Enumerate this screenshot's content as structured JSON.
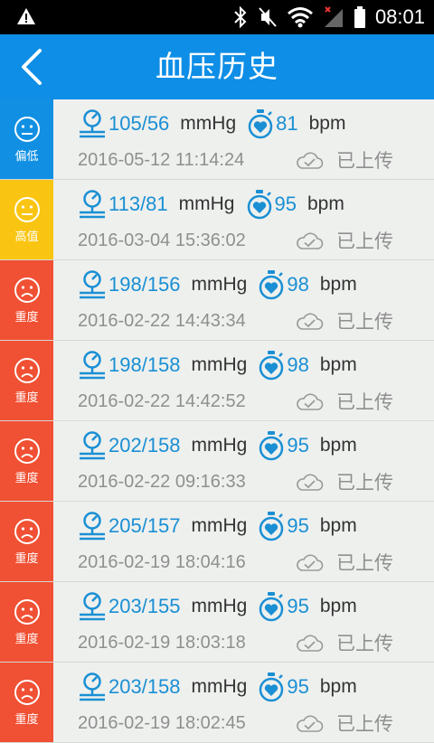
{
  "status_bar": {
    "time": "08:01"
  },
  "header": {
    "title": "血压历史"
  },
  "colors": {
    "low": "#1190e3",
    "high": "#f9c512",
    "severe": "#f05033",
    "accent": "#0e8ee6"
  },
  "records": [
    {
      "level": "偏低",
      "status": "low",
      "face": "neutral",
      "bp": "105/56",
      "bp_unit": "mmHg",
      "pulse": "81",
      "pulse_unit": "bpm",
      "time": "2016-05-12 11:14:24",
      "upload": "已上传"
    },
    {
      "level": "高值",
      "status": "high",
      "face": "neutral",
      "bp": "113/81",
      "bp_unit": "mmHg",
      "pulse": "95",
      "pulse_unit": "bpm",
      "time": "2016-03-04 15:36:02",
      "upload": "已上传"
    },
    {
      "level": "重度",
      "status": "severe",
      "face": "sad",
      "bp": "198/156",
      "bp_unit": "mmHg",
      "pulse": "98",
      "pulse_unit": "bpm",
      "time": "2016-02-22 14:43:34",
      "upload": "已上传"
    },
    {
      "level": "重度",
      "status": "severe",
      "face": "sad",
      "bp": "198/158",
      "bp_unit": "mmHg",
      "pulse": "98",
      "pulse_unit": "bpm",
      "time": "2016-02-22 14:42:52",
      "upload": "已上传"
    },
    {
      "level": "重度",
      "status": "severe",
      "face": "sad",
      "bp": "202/158",
      "bp_unit": "mmHg",
      "pulse": "95",
      "pulse_unit": "bpm",
      "time": "2016-02-22 09:16:33",
      "upload": "已上传"
    },
    {
      "level": "重度",
      "status": "severe",
      "face": "sad",
      "bp": "205/157",
      "bp_unit": "mmHg",
      "pulse": "95",
      "pulse_unit": "bpm",
      "time": "2016-02-19 18:04:16",
      "upload": "已上传"
    },
    {
      "level": "重度",
      "status": "severe",
      "face": "sad",
      "bp": "203/155",
      "bp_unit": "mmHg",
      "pulse": "95",
      "pulse_unit": "bpm",
      "time": "2016-02-19 18:03:18",
      "upload": "已上传"
    },
    {
      "level": "重度",
      "status": "severe",
      "face": "sad",
      "bp": "203/158",
      "bp_unit": "mmHg",
      "pulse": "95",
      "pulse_unit": "bpm",
      "time": "2016-02-19 18:02:45",
      "upload": "已上传"
    }
  ]
}
